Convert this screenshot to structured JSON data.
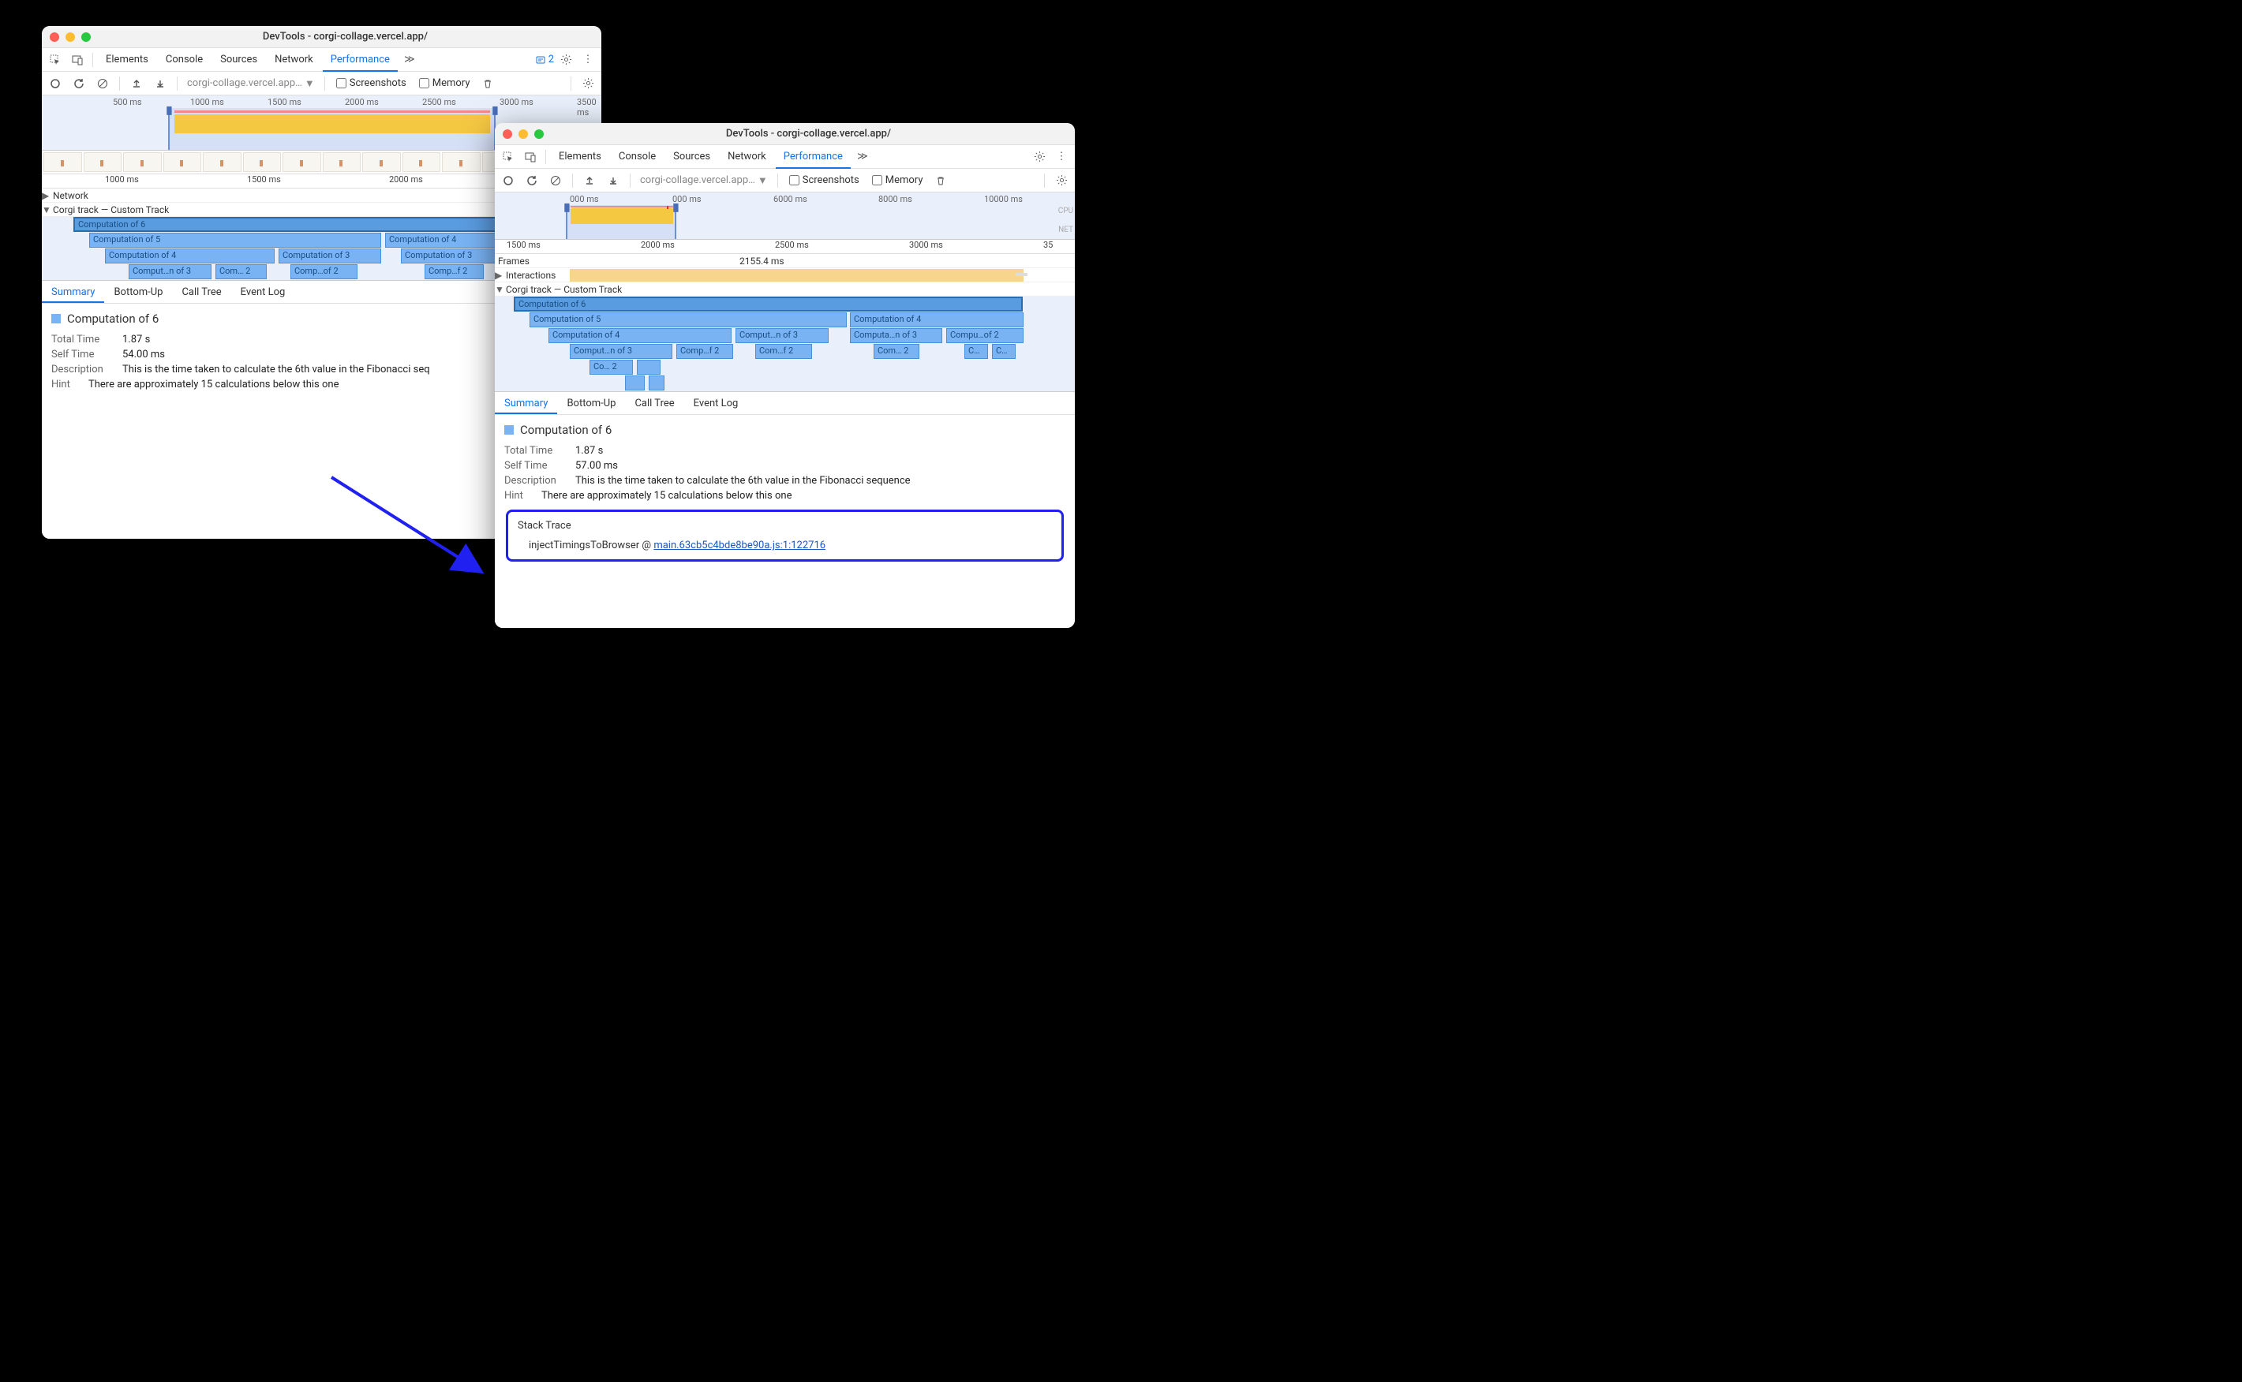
{
  "windowA": {
    "title": "DevTools - corgi-collage.vercel.app/",
    "tabs": [
      "Elements",
      "Console",
      "Sources",
      "Network",
      "Performance"
    ],
    "activeTab": "Performance",
    "overflowCount": "2",
    "url": "corgi-collage.vercel.app…",
    "checkScreenshots": "Screenshots",
    "checkMemory": "Memory",
    "overviewTicks": [
      "500 ms",
      "1000 ms",
      "1500 ms",
      "2000 ms",
      "2500 ms",
      "3000 ms",
      "3500 ms"
    ],
    "mainTicks": [
      "1000 ms",
      "1500 ms",
      "2000 ms"
    ],
    "networkLabel": "Network",
    "customTrackLabel": "Corgi track — Custom Track",
    "flame": {
      "l0": "Computation of 6",
      "l1a": "Computation of 5",
      "l1b": "Computation of 4",
      "l2a": "Computation of 4",
      "l2b": "Computation of 3",
      "l2c": "Computation of 3",
      "l3a": "Comput…n of 3",
      "l3b": "Com… 2",
      "l3c": "Comp…of 2",
      "l3d": "Comp…f 2"
    },
    "detailTabs": [
      "Summary",
      "Bottom-Up",
      "Call Tree",
      "Event Log"
    ],
    "activeDetail": "Summary",
    "summary": {
      "title": "Computation of 6",
      "totalTimeKey": "Total Time",
      "totalTimeVal": "1.87 s",
      "selfTimeKey": "Self Time",
      "selfTimeVal": "54.00 ms",
      "descKey": "Description",
      "descVal": "This is the time taken to calculate the 6th value in the Fibonacci seq",
      "hintKey": "Hint",
      "hintVal": "There are approximately 15 calculations below this one"
    }
  },
  "windowB": {
    "title": "DevTools - corgi-collage.vercel.app/",
    "tabs": [
      "Elements",
      "Console",
      "Sources",
      "Network",
      "Performance"
    ],
    "activeTab": "Performance",
    "url": "corgi-collage.vercel.app…",
    "checkScreenshots": "Screenshots",
    "checkMemory": "Memory",
    "overviewTicks": [
      "000 ms",
      "000 ms",
      "6000 ms",
      "8000 ms",
      "10000 ms"
    ],
    "cpuLabel": "CPU",
    "netLabel": "NET",
    "mainTicks": [
      "1500 ms",
      "2000 ms",
      "2500 ms",
      "3000 ms",
      "35"
    ],
    "framesLabel": "Frames",
    "frameTime": "2155.4 ms",
    "interactionsLabel": "Interactions",
    "customTrackLabel": "Corgi track — Custom Track",
    "flame": {
      "l0": "Computation of 6",
      "l1a": "Computation of 5",
      "l1b": "Computation of 4",
      "l2a": "Computation of 4",
      "l2b": "Comput…n of 3",
      "l2c": "Computa…n of 3",
      "l2d": "Compu…of 2",
      "l3a": "Comput…n of 3",
      "l3b": "Comp…f 2",
      "l3c": "Com…f 2",
      "l3d": "Com… 2",
      "l3e": "C…",
      "l3f": "C…",
      "l4a": "Co… 2",
      "l4b": ""
    },
    "detailTabs": [
      "Summary",
      "Bottom-Up",
      "Call Tree",
      "Event Log"
    ],
    "activeDetail": "Summary",
    "summary": {
      "title": "Computation of 6",
      "totalTimeKey": "Total Time",
      "totalTimeVal": "1.87 s",
      "selfTimeKey": "Self Time",
      "selfTimeVal": "57.00 ms",
      "descKey": "Description",
      "descVal": "This is the time taken to calculate the 6th value in the Fibonacci sequence",
      "hintKey": "Hint",
      "hintVal": "There are approximately 15 calculations below this one",
      "stackTitle": "Stack Trace",
      "stackFn": "injectTimingsToBrowser @ ",
      "stackLink": "main.63cb5c4bde8be90a.js:1:122716"
    }
  }
}
